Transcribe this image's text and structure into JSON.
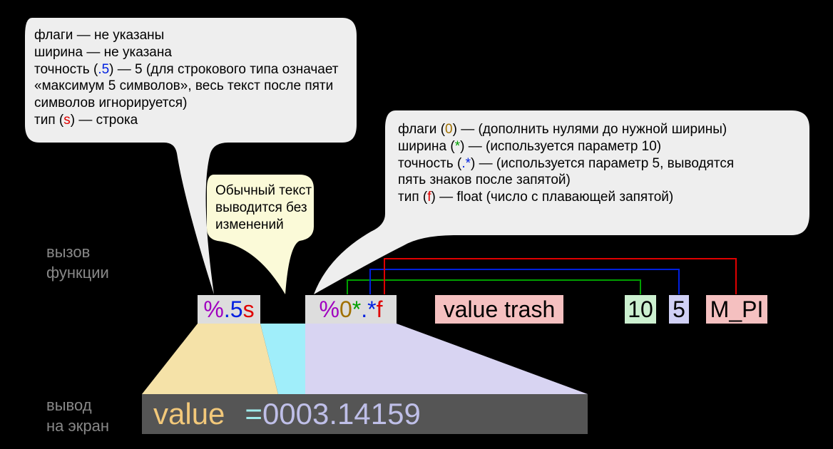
{
  "labels": {
    "call": "вызов\nфункции",
    "output": "вывод\nна экран"
  },
  "bubble_left": {
    "line1": "флаги — не указаны",
    "line2": "ширина — не указана",
    "line3_a": "точность (",
    "line3_prec": ".5",
    "line3_b": ") — 5 (для строкового типа означает",
    "line4": "«максимум 5 символов», весь текст после пяти",
    "line5": "символов игнорируется)",
    "line6_a": "тип (",
    "line6_type": "s",
    "line6_b": ") — строка"
  },
  "bubble_center": {
    "line1": "Обычный текст",
    "line2": "выводится без",
    "line3": "изменений"
  },
  "bubble_right": {
    "l1a": "флаги (",
    "l1flag": "0",
    "l1b": ") — (дополнить нулями до нужной ширины)",
    "l2a": "ширина (",
    "l2w": "*",
    "l2b": ") — (используется параметр 10)",
    "l3a": "точность (",
    "l3p": ".*",
    "l3b": ") — (используется параметр 5, выводятся",
    "l4": "пять знаков после запятой)",
    "l5a": "тип (",
    "l5t": "f",
    "l5b": ") — float (число с плавающей запятой)"
  },
  "tokens": {
    "fmt1_pct": "%",
    "fmt1_prec": ".5",
    "fmt1_type": "s",
    "fmt2_pct": "%",
    "fmt2_flag": "0",
    "fmt2_w": "*",
    "fmt2_dot": ".",
    "fmt2_p": "*",
    "fmt2_type": "f",
    "arg_str": "value trash",
    "arg_w": "10",
    "arg_p": "5",
    "arg_v": "M_PI"
  },
  "output": {
    "value": "value",
    "eq": " = ",
    "num": "0003.14159"
  }
}
